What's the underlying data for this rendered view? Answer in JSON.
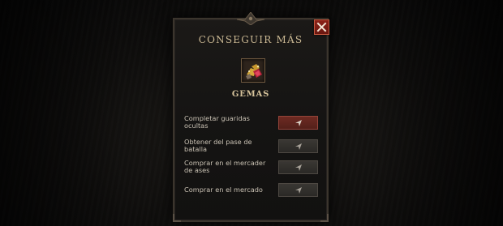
{
  "dialog": {
    "title": "CONSEGUIR MÁS",
    "item_name": "GEMAS",
    "item_icon": "gem-pile-icon",
    "close_icon": "close-icon"
  },
  "options": [
    {
      "label": "Completar guaridas ocultas",
      "highlighted": true
    },
    {
      "label": "Obtener del pase de batalla",
      "highlighted": false
    },
    {
      "label": "Comprar en el mercader de ases",
      "highlighted": false
    },
    {
      "label": "Comprar en el mercado",
      "highlighted": false
    }
  ],
  "colors": {
    "accent_red": "#6e2a22",
    "title_gold": "#c9b792"
  }
}
